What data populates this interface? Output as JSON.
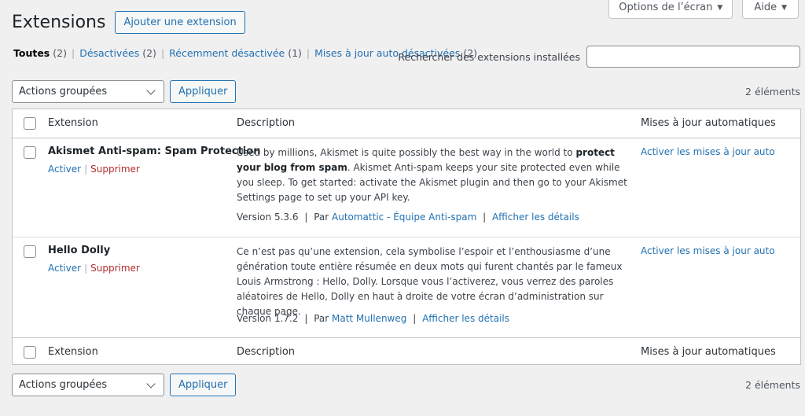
{
  "screen_meta": {
    "options_label": "Options de l’écran",
    "help_label": "Aide"
  },
  "header": {
    "title": "Extensions",
    "add_button": "Ajouter une extension"
  },
  "filters": [
    {
      "label": "Toutes",
      "count": "(2)"
    },
    {
      "label": "Désactivées",
      "count": "(2)"
    },
    {
      "label": "Récemment désactivée",
      "count": "(1)"
    },
    {
      "label": "Mises à jour auto désactivées",
      "count": "(2)"
    }
  ],
  "search": {
    "label": "Rechercher des extensions installées",
    "value": ""
  },
  "bulk": {
    "select_value": "Actions groupées",
    "apply_label": "Appliquer",
    "count": "2 éléments"
  },
  "columns": {
    "name": "Extension",
    "description": "Description",
    "auto_updates": "Mises à jour automatiques"
  },
  "plugins": [
    {
      "name": "Akismet Anti-spam: Spam Protection",
      "activate": "Activer",
      "delete": "Supprimer",
      "desc_before": "Used by millions, Akismet is quite possibly the best way in the world to ",
      "desc_bold": "protect your blog from spam",
      "desc_after": ". Akismet Anti-spam keeps your site protected even while you sleep. To get started: activate the Akismet plugin and then go to your Akismet Settings page to set up your API key.",
      "version": "Version 5.3.6",
      "by": "Par",
      "author": "Automattic - Équipe Anti-spam",
      "details": "Afficher les détails",
      "auto_link": "Activer les mises à jour auto"
    },
    {
      "name": "Hello Dolly",
      "activate": "Activer",
      "delete": "Supprimer",
      "desc_before": "Ce n’est pas qu’une extension, cela symbolise l’espoir et l’enthousiasme d’une génération toute entière résumée en deux mots qui furent chantés par le fameux Louis Armstrong : Hello, Dolly. Lorsque vous l’activerez, vous verrez des paroles aléatoires de Hello, Dolly en haut à droite de votre écran d’administration sur chaque page.",
      "desc_bold": "",
      "desc_after": "",
      "version": "Version 1.7.2",
      "by": "Par",
      "author": "Matt Mullenweg",
      "details": "Afficher les détails",
      "auto_link": "Activer les mises à jour auto"
    }
  ]
}
